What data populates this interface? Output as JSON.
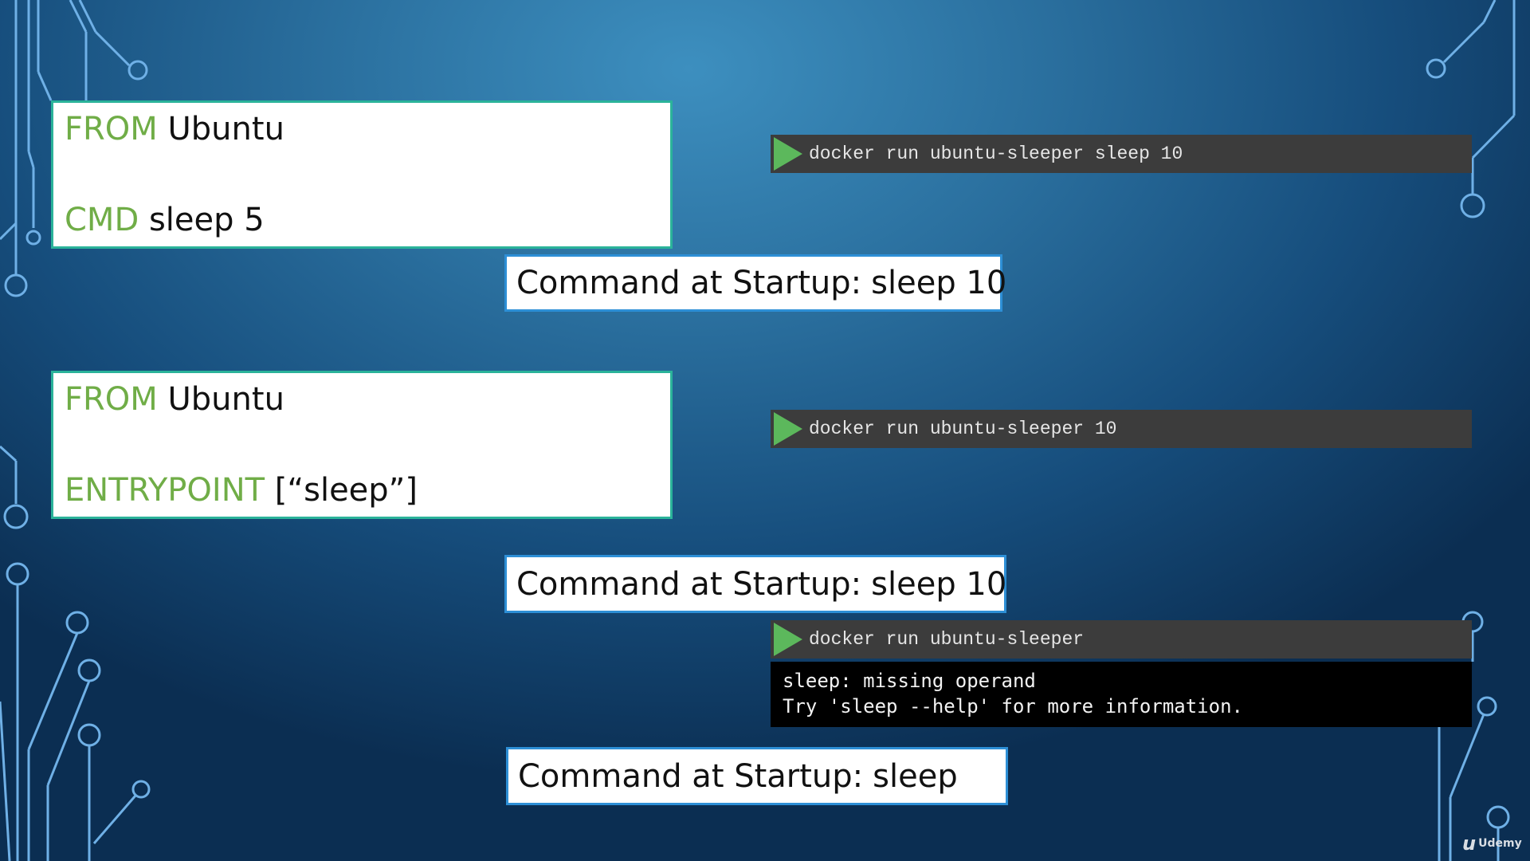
{
  "colors": {
    "keyword": "#70ad47",
    "code_border": "#2bb39a",
    "startup_border": "#2d8fd6",
    "terminal_bg": "#3c3c3c",
    "play_icon": "#5cb85c",
    "output_bg": "#000000"
  },
  "dockerfile1": {
    "from_kw": "FROM",
    "from_val": "Ubuntu",
    "cmd_kw": "CMD",
    "cmd_val": "sleep 5"
  },
  "dockerfile2": {
    "from_kw": "FROM",
    "from_val": "Ubuntu",
    "entry_kw": "ENTRYPOINT",
    "entry_val": "[“sleep”]"
  },
  "terminals": [
    {
      "icon": "play-icon",
      "command": "docker run ubuntu-sleeper sleep 10"
    },
    {
      "icon": "play-icon",
      "command": "docker run ubuntu-sleeper 10"
    },
    {
      "icon": "play-icon",
      "command": "docker run ubuntu-sleeper"
    }
  ],
  "output": {
    "line1": "sleep: missing operand",
    "line2": "Try 'sleep --help' for more information."
  },
  "startups": [
    {
      "label": "Command at Startup:",
      "value": "sleep 10"
    },
    {
      "label": "Command at Startup:",
      "value": "sleep 10"
    },
    {
      "label": "Command at Startup:",
      "value": "sleep"
    }
  ],
  "logo": {
    "icon": "udemy-logo-icon",
    "text": "Udemy",
    "mark": "u"
  }
}
